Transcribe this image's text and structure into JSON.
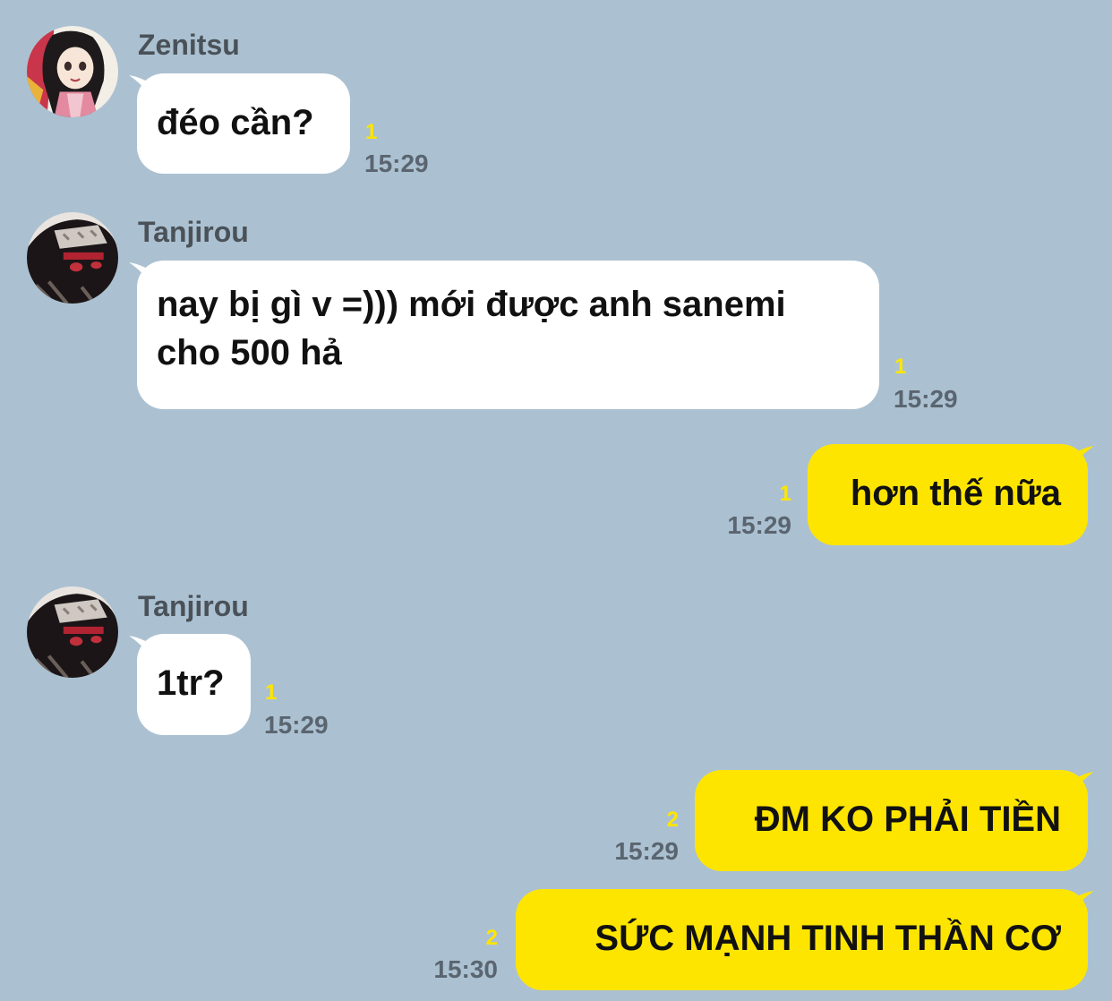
{
  "messages": [
    {
      "sender": "Zenitsu",
      "text": "đéo cần?",
      "unread": "1",
      "time": "15:29",
      "outgoing": false
    },
    {
      "sender": "Tanjirou",
      "text_lines": [
        "nay bị gì v =))) mới được anh sanemi",
        "cho 500 hả"
      ],
      "unread": "1",
      "time": "15:29",
      "outgoing": false
    },
    {
      "text": "hơn thế nữa",
      "unread": "1",
      "time": "15:29",
      "outgoing": true
    },
    {
      "sender": "Tanjirou",
      "text": "1tr?",
      "unread": "1",
      "time": "15:29",
      "outgoing": false
    },
    {
      "text": "ĐM KO PHẢI TIỀN",
      "unread": "2",
      "time": "15:29",
      "outgoing": true
    },
    {
      "text": "SỨC MẠNH TINH THẦN CƠ",
      "unread": "2",
      "time": "15:30",
      "outgoing": true
    }
  ],
  "colors": {
    "background": "#abc1d1",
    "incoming_bubble": "#ffffff",
    "outgoing_bubble": "#fee500",
    "unread_count": "#fee500",
    "timestamp": "#5a6570"
  },
  "icons": {
    "zenitsu_avatar": "avatar-image",
    "tanjirou_avatar": "avatar-image"
  }
}
